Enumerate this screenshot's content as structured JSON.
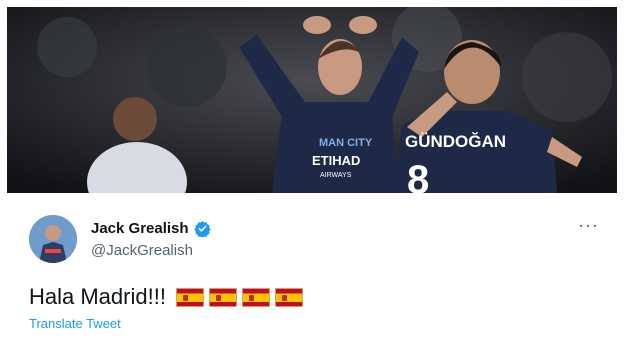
{
  "photo": {
    "jersey_front_text_1": "MAN CITY",
    "jersey_front_text_2": "ETIHAD",
    "jersey_front_text_3": "AIRWAYS",
    "jersey_back_name": "GÜNDOĞAN",
    "jersey_back_number": "8"
  },
  "tweet": {
    "display_name": "Jack Grealish",
    "handle": "@JackGrealish",
    "text": "Hala Madrid!!!",
    "flags": [
      "spain-flag",
      "spain-flag",
      "spain-flag",
      "spain-flag"
    ],
    "translate_label": "Translate Tweet",
    "more_label": "···"
  },
  "colors": {
    "link": "#1d9bf0",
    "verified": "#1d9bf0",
    "name": "#0f1419",
    "secondary": "#536471"
  }
}
